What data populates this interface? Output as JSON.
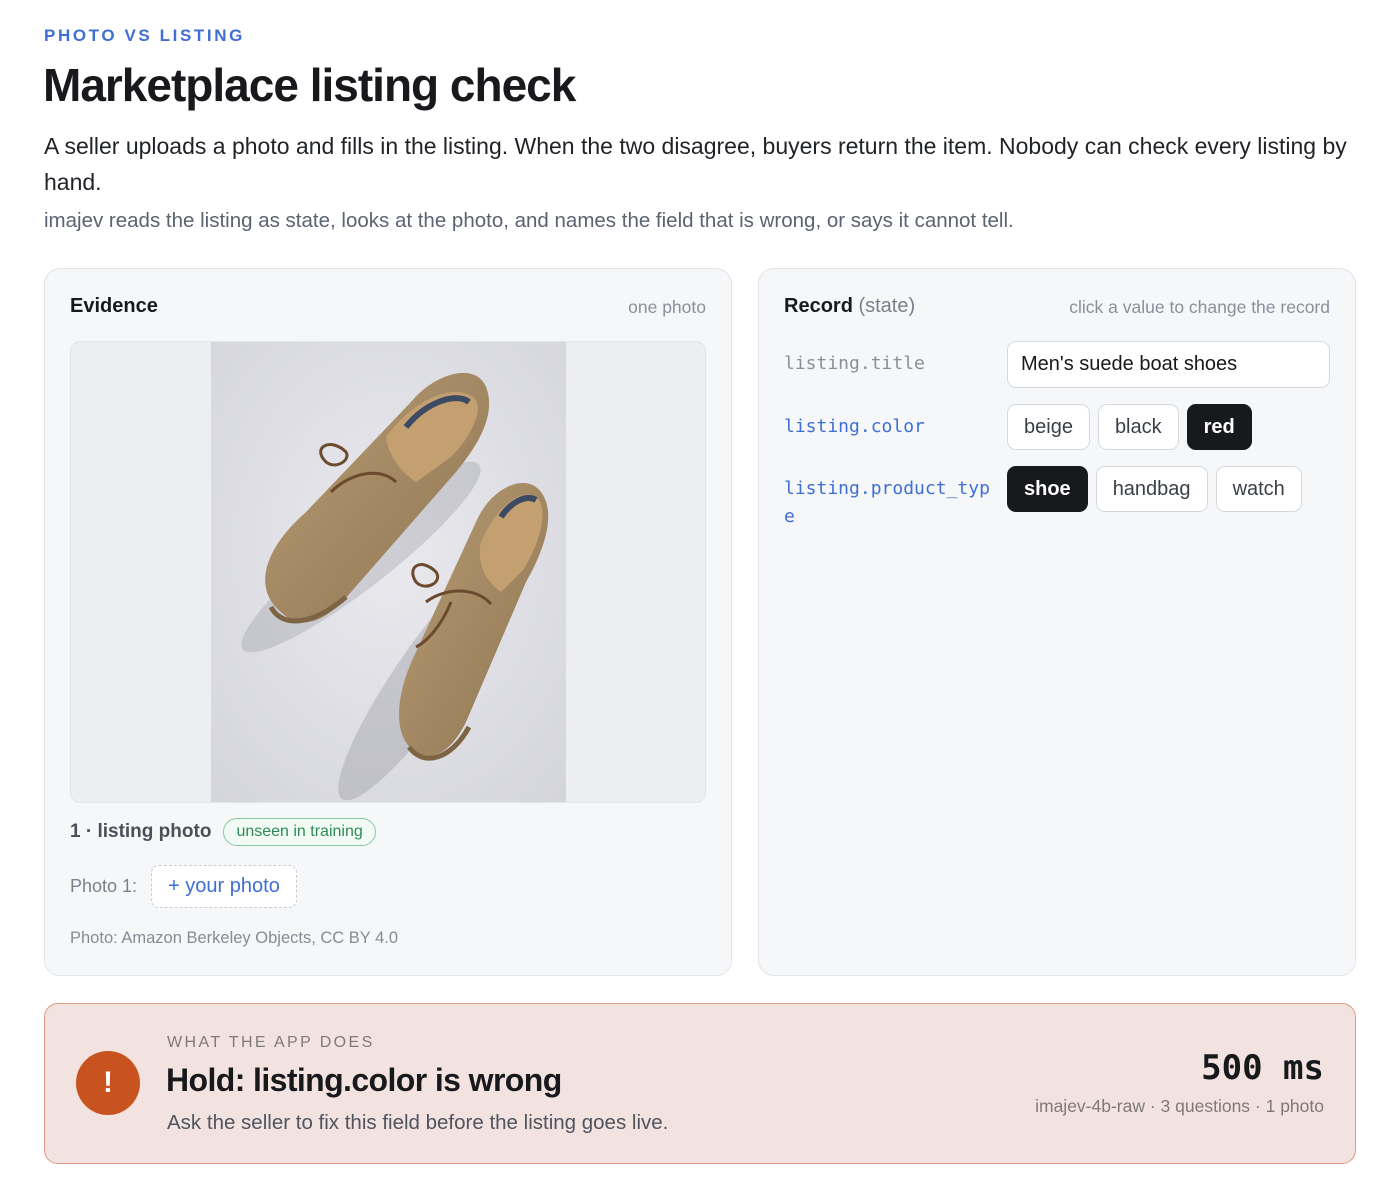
{
  "header": {
    "eyebrow": "PHOTO VS LISTING",
    "title": "Marketplace listing check",
    "lead": "A seller uploads a photo and fills in the listing. When the two disagree, buyers return the item. Nobody can check every listing by hand.",
    "sub": "imajev reads the listing as state, looks at the photo, and names the field that is wrong, or says it cannot tell."
  },
  "evidence": {
    "title": "Evidence",
    "hint": "one photo",
    "photo_caption": "1 · listing photo",
    "badge": "unseen in training",
    "upload_label": "Photo 1:",
    "upload_button": "+ your photo",
    "credit": "Photo: Amazon Berkeley Objects, CC BY 4.0",
    "photo_subject": "tan suede boat shoes"
  },
  "record": {
    "title": "Record",
    "title_suffix": "(state)",
    "hint": "click a value to change the record",
    "fields": [
      {
        "key": "listing.title",
        "value": "Men's suede boat shoes"
      },
      {
        "key": "listing.color",
        "options": [
          "beige",
          "black",
          "red"
        ],
        "selected": "red"
      },
      {
        "key": "listing.product_type",
        "options": [
          "shoe",
          "handbag",
          "watch"
        ],
        "selected": "shoe"
      }
    ]
  },
  "verdict": {
    "eyebrow": "WHAT THE APP DOES",
    "icon": "exclamation-icon",
    "icon_glyph": "!",
    "title": "Hold: listing.color is wrong",
    "detail": "Ask the seller to fix this field before the listing goes live.",
    "latency": "500 ms",
    "meta": "imajev-4b-raw · 3 questions · 1 photo",
    "accent_color": "#c8531f"
  }
}
